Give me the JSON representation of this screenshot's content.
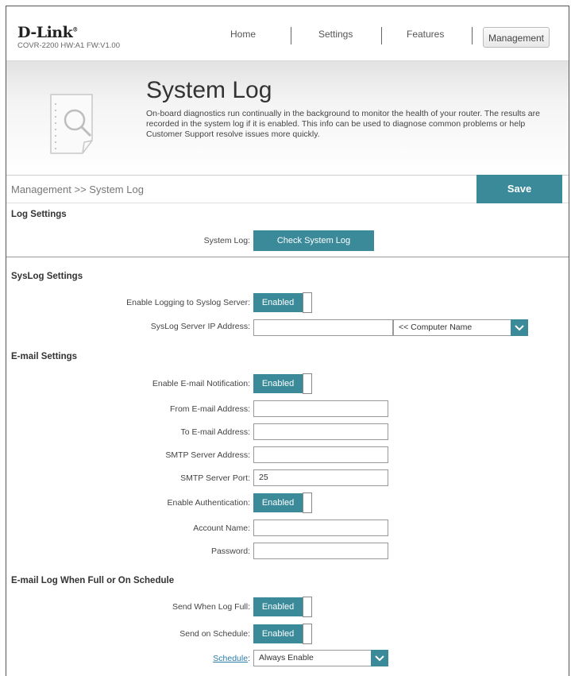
{
  "brand": {
    "logo": "D-Link",
    "model": "COVR-2200 HW:A1 FW:V1.00"
  },
  "nav": {
    "home": "Home",
    "settings": "Settings",
    "features": "Features",
    "management": "Management"
  },
  "banner": {
    "title": "System Log",
    "description": "On-board diagnostics run continually in the background to monitor the health of your router. The results are recorded in the system log if it is enabled. This info can be used to diagnose common problems or help Customer Support resolve issues more quickly."
  },
  "breadcrumb": "Management >> System Log",
  "save_label": "Save",
  "log_settings": {
    "title": "Log Settings",
    "system_log_label": "System Log:",
    "check_button": "Check System Log"
  },
  "syslog": {
    "title": "SysLog Settings",
    "enable_label": "Enable Logging to Syslog Server:",
    "enable_value": "Enabled",
    "ip_label": "SysLog Server IP Address:",
    "ip_value": "",
    "computer_select": "<< Computer Name"
  },
  "email": {
    "title": "E-mail Settings",
    "enable_label": "Enable E-mail Notification:",
    "enable_value": "Enabled",
    "from_label": "From E-mail Address:",
    "from_value": "",
    "to_label": "To E-mail Address:",
    "to_value": "",
    "smtp_label": "SMTP Server Address:",
    "smtp_value": "",
    "port_label": "SMTP Server Port:",
    "port_value": "25",
    "auth_label": "Enable Authentication:",
    "auth_value": "Enabled",
    "account_label": "Account Name:",
    "account_value": "",
    "password_label": "Password:",
    "password_value": ""
  },
  "email_log": {
    "title": "E-mail Log When Full or On Schedule",
    "full_label": "Send When Log Full:",
    "full_value": "Enabled",
    "schedule_send_label": "Send on Schedule:",
    "schedule_send_value": "Enabled",
    "schedule_link": "Schedule",
    "schedule_colon": ":",
    "schedule_value": "Always Enable"
  },
  "colors": {
    "accent": "#3a8a9a",
    "link": "#2a7aa8"
  }
}
